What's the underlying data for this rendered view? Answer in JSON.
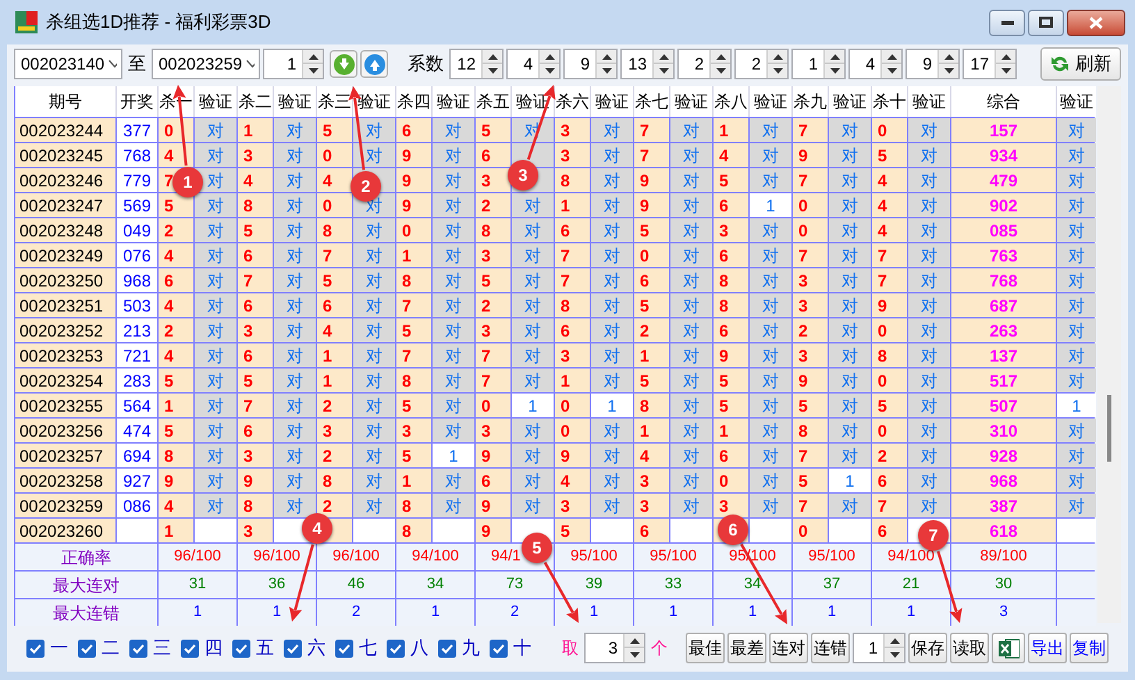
{
  "window": {
    "title": "杀组选1D推荐 - 福利彩票3D"
  },
  "toolbar": {
    "from_period": "002023140",
    "to_label": "至",
    "to_period": "002023259",
    "step": "1",
    "coef_label": "系数",
    "coefficients": [
      "12",
      "4",
      "9",
      "13",
      "2",
      "2",
      "1",
      "4",
      "9",
      "17"
    ],
    "refresh_label": "刷新"
  },
  "table": {
    "columns": [
      "期号",
      "开奖",
      "杀一",
      "验证",
      "杀二",
      "验证",
      "杀三",
      "验证",
      "杀四",
      "验证",
      "杀五",
      "验证",
      "杀六",
      "验证",
      "杀七",
      "验证",
      "杀八",
      "验证",
      "杀九",
      "验证",
      "杀十",
      "验证",
      "综合",
      "验证"
    ],
    "rows": [
      {
        "period": "002023244",
        "draw": "377",
        "kills": [
          {
            "num": "0",
            "check": "对",
            "ok": true
          },
          {
            "num": "1",
            "check": "对",
            "ok": true
          },
          {
            "num": "5",
            "check": "对",
            "ok": true
          },
          {
            "num": "6",
            "check": "对",
            "ok": true
          },
          {
            "num": "5",
            "check": "对",
            "ok": true
          },
          {
            "num": "3",
            "check": "对",
            "ok": true
          },
          {
            "num": "7",
            "check": "对",
            "ok": true
          },
          {
            "num": "1",
            "check": "对",
            "ok": true
          },
          {
            "num": "7",
            "check": "对",
            "ok": true
          },
          {
            "num": "0",
            "check": "对",
            "ok": true
          }
        ],
        "composite": {
          "num": "157",
          "check": "对",
          "ok": true
        }
      },
      {
        "period": "002023245",
        "draw": "768",
        "kills": [
          {
            "num": "4",
            "check": "对",
            "ok": true
          },
          {
            "num": "3",
            "check": "对",
            "ok": true
          },
          {
            "num": "0",
            "check": "对",
            "ok": true
          },
          {
            "num": "9",
            "check": "对",
            "ok": true
          },
          {
            "num": "6",
            "ok": true
          },
          {
            "num": "3",
            "check": "对",
            "ok": true
          },
          {
            "num": "7",
            "check": "对",
            "ok": true
          },
          {
            "num": "4",
            "check": "对",
            "ok": true
          },
          {
            "num": "9",
            "check": "对",
            "ok": true
          },
          {
            "num": "5",
            "check": "对",
            "ok": true
          }
        ],
        "composite": {
          "num": "934",
          "check": "对",
          "ok": true
        }
      },
      {
        "period": "002023246",
        "draw": "779",
        "kills": [
          {
            "num": "7",
            "check": "对",
            "ok": true
          },
          {
            "num": "4",
            "check": "对",
            "ok": true
          },
          {
            "num": "4",
            "ok": true
          },
          {
            "num": "9",
            "check": "对",
            "ok": true
          },
          {
            "num": "3",
            "ok": true
          },
          {
            "num": "8",
            "check": "对",
            "ok": true
          },
          {
            "num": "9",
            "check": "对",
            "ok": true
          },
          {
            "num": "5",
            "check": "对",
            "ok": true
          },
          {
            "num": "7",
            "check": "对",
            "ok": true
          },
          {
            "num": "4",
            "check": "对",
            "ok": true
          }
        ],
        "composite": {
          "num": "479",
          "check": "对",
          "ok": true
        }
      },
      {
        "period": "002023247",
        "draw": "569",
        "kills": [
          {
            "num": "5",
            "check": "对",
            "ok": true
          },
          {
            "num": "8",
            "check": "对",
            "ok": true
          },
          {
            "num": "0",
            "check": "对",
            "ok": true
          },
          {
            "num": "9",
            "check": "对",
            "ok": true
          },
          {
            "num": "2",
            "check": "对",
            "ok": true
          },
          {
            "num": "1",
            "check": "对",
            "ok": true
          },
          {
            "num": "9",
            "check": "对",
            "ok": true
          },
          {
            "num": "6",
            "check": "1",
            "ok": false
          },
          {
            "num": "0",
            "check": "对",
            "ok": true
          },
          {
            "num": "4",
            "check": "对",
            "ok": true
          }
        ],
        "composite": {
          "num": "902",
          "check": "对",
          "ok": true
        }
      },
      {
        "period": "002023248",
        "draw": "049",
        "kills": [
          {
            "num": "2",
            "check": "对",
            "ok": true
          },
          {
            "num": "5",
            "check": "对",
            "ok": true
          },
          {
            "num": "8",
            "check": "对",
            "ok": true
          },
          {
            "num": "0",
            "check": "对",
            "ok": true
          },
          {
            "num": "8",
            "check": "对",
            "ok": true
          },
          {
            "num": "6",
            "check": "对",
            "ok": true
          },
          {
            "num": "5",
            "check": "对",
            "ok": true
          },
          {
            "num": "3",
            "check": "对",
            "ok": true
          },
          {
            "num": "0",
            "check": "对",
            "ok": true
          },
          {
            "num": "4",
            "check": "对",
            "ok": true
          }
        ],
        "composite": {
          "num": "085",
          "check": "对",
          "ok": true
        }
      },
      {
        "period": "002023249",
        "draw": "076",
        "kills": [
          {
            "num": "4",
            "check": "对",
            "ok": true
          },
          {
            "num": "6",
            "check": "对",
            "ok": true
          },
          {
            "num": "7",
            "check": "对",
            "ok": true
          },
          {
            "num": "1",
            "check": "对",
            "ok": true
          },
          {
            "num": "3",
            "check": "对",
            "ok": true
          },
          {
            "num": "7",
            "check": "对",
            "ok": true
          },
          {
            "num": "0",
            "check": "对",
            "ok": true
          },
          {
            "num": "6",
            "check": "对",
            "ok": true
          },
          {
            "num": "7",
            "check": "对",
            "ok": true
          },
          {
            "num": "7",
            "check": "对",
            "ok": true
          }
        ],
        "composite": {
          "num": "763",
          "check": "对",
          "ok": true
        }
      },
      {
        "period": "002023250",
        "draw": "968",
        "kills": [
          {
            "num": "6",
            "check": "对",
            "ok": true
          },
          {
            "num": "7",
            "check": "对",
            "ok": true
          },
          {
            "num": "5",
            "check": "对",
            "ok": true
          },
          {
            "num": "8",
            "check": "对",
            "ok": true
          },
          {
            "num": "5",
            "check": "对",
            "ok": true
          },
          {
            "num": "7",
            "check": "对",
            "ok": true
          },
          {
            "num": "6",
            "check": "对",
            "ok": true
          },
          {
            "num": "8",
            "check": "对",
            "ok": true
          },
          {
            "num": "3",
            "check": "对",
            "ok": true
          },
          {
            "num": "7",
            "check": "对",
            "ok": true
          }
        ],
        "composite": {
          "num": "768",
          "check": "对",
          "ok": true
        }
      },
      {
        "period": "002023251",
        "draw": "503",
        "kills": [
          {
            "num": "4",
            "check": "对",
            "ok": true
          },
          {
            "num": "6",
            "check": "对",
            "ok": true
          },
          {
            "num": "6",
            "check": "对",
            "ok": true
          },
          {
            "num": "7",
            "check": "对",
            "ok": true
          },
          {
            "num": "2",
            "check": "对",
            "ok": true
          },
          {
            "num": "8",
            "check": "对",
            "ok": true
          },
          {
            "num": "5",
            "check": "对",
            "ok": true
          },
          {
            "num": "8",
            "check": "对",
            "ok": true
          },
          {
            "num": "3",
            "check": "对",
            "ok": true
          },
          {
            "num": "9",
            "check": "对",
            "ok": true
          }
        ],
        "composite": {
          "num": "687",
          "check": "对",
          "ok": true
        }
      },
      {
        "period": "002023252",
        "draw": "213",
        "kills": [
          {
            "num": "2",
            "check": "对",
            "ok": true
          },
          {
            "num": "3",
            "check": "对",
            "ok": true
          },
          {
            "num": "4",
            "check": "对",
            "ok": true
          },
          {
            "num": "5",
            "check": "对",
            "ok": true
          },
          {
            "num": "3",
            "check": "对",
            "ok": true
          },
          {
            "num": "6",
            "check": "对",
            "ok": true
          },
          {
            "num": "2",
            "check": "对",
            "ok": true
          },
          {
            "num": "6",
            "check": "对",
            "ok": true
          },
          {
            "num": "2",
            "check": "对",
            "ok": true
          },
          {
            "num": "0",
            "check": "对",
            "ok": true
          }
        ],
        "composite": {
          "num": "263",
          "check": "对",
          "ok": true
        }
      },
      {
        "period": "002023253",
        "draw": "721",
        "kills": [
          {
            "num": "4",
            "check": "对",
            "ok": true
          },
          {
            "num": "6",
            "check": "对",
            "ok": true
          },
          {
            "num": "1",
            "check": "对",
            "ok": true
          },
          {
            "num": "7",
            "check": "对",
            "ok": true
          },
          {
            "num": "7",
            "check": "对",
            "ok": true
          },
          {
            "num": "3",
            "check": "对",
            "ok": true
          },
          {
            "num": "1",
            "check": "对",
            "ok": true
          },
          {
            "num": "9",
            "check": "对",
            "ok": true
          },
          {
            "num": "3",
            "check": "对",
            "ok": true
          },
          {
            "num": "8",
            "check": "对",
            "ok": true
          }
        ],
        "composite": {
          "num": "137",
          "check": "对",
          "ok": true
        }
      },
      {
        "period": "002023254",
        "draw": "283",
        "kills": [
          {
            "num": "5",
            "check": "对",
            "ok": true
          },
          {
            "num": "5",
            "check": "对",
            "ok": true
          },
          {
            "num": "1",
            "check": "对",
            "ok": true
          },
          {
            "num": "8",
            "check": "对",
            "ok": true
          },
          {
            "num": "7",
            "check": "对",
            "ok": true
          },
          {
            "num": "1",
            "check": "对",
            "ok": true
          },
          {
            "num": "5",
            "check": "对",
            "ok": true
          },
          {
            "num": "5",
            "check": "对",
            "ok": true
          },
          {
            "num": "9",
            "check": "对",
            "ok": true
          },
          {
            "num": "0",
            "check": "对",
            "ok": true
          }
        ],
        "composite": {
          "num": "517",
          "check": "对",
          "ok": true
        }
      },
      {
        "period": "002023255",
        "draw": "564",
        "kills": [
          {
            "num": "1",
            "check": "对",
            "ok": true
          },
          {
            "num": "7",
            "check": "对",
            "ok": true
          },
          {
            "num": "2",
            "check": "对",
            "ok": true
          },
          {
            "num": "5",
            "check": "对",
            "ok": true
          },
          {
            "num": "0",
            "check": "1",
            "ok": false
          },
          {
            "num": "0",
            "check": "1",
            "ok": false
          },
          {
            "num": "8",
            "check": "对",
            "ok": true
          },
          {
            "num": "5",
            "check": "对",
            "ok": true
          },
          {
            "num": "5",
            "check": "对",
            "ok": true
          },
          {
            "num": "5",
            "check": "对",
            "ok": true
          }
        ],
        "composite": {
          "num": "507",
          "check": "1",
          "ok": false
        }
      },
      {
        "period": "002023256",
        "draw": "474",
        "kills": [
          {
            "num": "5",
            "check": "对",
            "ok": true
          },
          {
            "num": "6",
            "check": "对",
            "ok": true
          },
          {
            "num": "3",
            "check": "对",
            "ok": true
          },
          {
            "num": "3",
            "check": "对",
            "ok": true
          },
          {
            "num": "3",
            "check": "对",
            "ok": true
          },
          {
            "num": "0",
            "check": "对",
            "ok": true
          },
          {
            "num": "1",
            "check": "对",
            "ok": true
          },
          {
            "num": "1",
            "check": "对",
            "ok": true
          },
          {
            "num": "8",
            "check": "对",
            "ok": true
          },
          {
            "num": "0",
            "check": "对",
            "ok": true
          }
        ],
        "composite": {
          "num": "310",
          "check": "对",
          "ok": true
        }
      },
      {
        "period": "002023257",
        "draw": "694",
        "kills": [
          {
            "num": "8",
            "check": "对",
            "ok": true
          },
          {
            "num": "3",
            "check": "对",
            "ok": true
          },
          {
            "num": "2",
            "check": "对",
            "ok": true
          },
          {
            "num": "5",
            "check": "1",
            "ok": false
          },
          {
            "num": "9",
            "check": "对",
            "ok": true
          },
          {
            "num": "9",
            "check": "对",
            "ok": true
          },
          {
            "num": "4",
            "check": "对",
            "ok": true
          },
          {
            "num": "6",
            "check": "对",
            "ok": true
          },
          {
            "num": "7",
            "check": "对",
            "ok": true
          },
          {
            "num": "2",
            "check": "对",
            "ok": true
          }
        ],
        "composite": {
          "num": "928",
          "check": "对",
          "ok": true
        }
      },
      {
        "period": "002023258",
        "draw": "927",
        "kills": [
          {
            "num": "9",
            "check": "对",
            "ok": true
          },
          {
            "num": "9",
            "check": "对",
            "ok": true
          },
          {
            "num": "8",
            "check": "对",
            "ok": true
          },
          {
            "num": "1",
            "check": "对",
            "ok": true
          },
          {
            "num": "6",
            "check": "对",
            "ok": true
          },
          {
            "num": "4",
            "check": "对",
            "ok": true
          },
          {
            "num": "3",
            "check": "对",
            "ok": true
          },
          {
            "num": "0",
            "check": "对",
            "ok": true
          },
          {
            "num": "5",
            "check": "1",
            "ok": false
          },
          {
            "num": "6",
            "check": "对",
            "ok": true
          }
        ],
        "composite": {
          "num": "968",
          "check": "对",
          "ok": true
        }
      },
      {
        "period": "002023259",
        "draw": "086",
        "kills": [
          {
            "num": "4",
            "check": "对",
            "ok": true
          },
          {
            "num": "8",
            "check": "对",
            "ok": true
          },
          {
            "num": "2",
            "check": "对",
            "ok": true
          },
          {
            "num": "8",
            "check": "对",
            "ok": true
          },
          {
            "num": "9",
            "check": "对",
            "ok": true
          },
          {
            "num": "3",
            "check": "对",
            "ok": true
          },
          {
            "num": "3",
            "check": "对",
            "ok": true
          },
          {
            "num": "3",
            "check": "对",
            "ok": true
          },
          {
            "num": "7",
            "check": "对",
            "ok": true
          },
          {
            "num": "7",
            "check": "对",
            "ok": true
          }
        ],
        "composite": {
          "num": "387",
          "check": "对",
          "ok": true
        }
      },
      {
        "period": "002023260",
        "kills": [
          {
            "num": "1",
            "ok": false
          },
          {
            "num": "3",
            "ok": false
          },
          {
            "ok": false
          },
          {
            "num": "8",
            "ok": false
          },
          {
            "num": "9",
            "ok": false
          },
          {
            "num": "5",
            "ok": false
          },
          {
            "num": "6",
            "ok": false
          },
          {
            "ok": false
          },
          {
            "num": "0",
            "ok": false
          },
          {
            "num": "6",
            "ok": false
          }
        ],
        "composite": {
          "num": "618",
          "ok": false
        }
      }
    ],
    "summary": [
      {
        "label": "正确率",
        "kind": "rate",
        "values": [
          "96/100",
          "96/100",
          "96/100",
          "94/100",
          "94/1",
          "95/100",
          "95/100",
          "95/100",
          "95/100",
          "94/100",
          "89/100"
        ]
      },
      {
        "label": "最大连对",
        "kind": "streak_hit",
        "values": [
          "31",
          "36",
          "46",
          "34",
          "73",
          "39",
          "33",
          "34",
          "37",
          "21",
          "30"
        ]
      },
      {
        "label": "最大连错",
        "kind": "streak_miss",
        "values": [
          "1",
          "1",
          "2",
          "1",
          "2",
          "1",
          "1",
          "1",
          "1",
          "1",
          "3"
        ]
      }
    ]
  },
  "bottom": {
    "options": [
      {
        "label": "一",
        "checked": true
      },
      {
        "label": "二",
        "checked": true
      },
      {
        "label": "三",
        "checked": true
      },
      {
        "label": "四",
        "checked": true
      },
      {
        "label": "五",
        "checked": true
      },
      {
        "label": "六",
        "checked": true
      },
      {
        "label": "七",
        "checked": true
      },
      {
        "label": "八",
        "checked": true
      },
      {
        "label": "九",
        "checked": true
      },
      {
        "label": "十",
        "checked": true
      }
    ],
    "take_label": "取",
    "take_value": "3",
    "take_unit": "个",
    "sort_buttons": [
      "最佳",
      "最差",
      "连对",
      "连错"
    ],
    "count_value": "1",
    "file_buttons": [
      "保存",
      "读取"
    ],
    "export_buttons": [
      "导出",
      "复制"
    ]
  },
  "annotations": [
    "1",
    "2",
    "3",
    "4",
    "5",
    "6",
    "7"
  ]
}
